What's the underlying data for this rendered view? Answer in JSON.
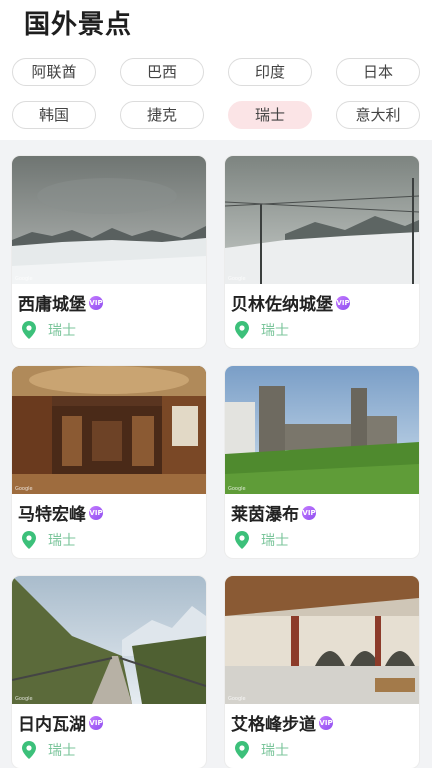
{
  "header": {
    "title": "国外景点"
  },
  "chips": [
    {
      "label": "阿联酋",
      "active": false
    },
    {
      "label": "巴西",
      "active": false
    },
    {
      "label": "印度",
      "active": false
    },
    {
      "label": "日本",
      "active": false
    },
    {
      "label": "韩国",
      "active": false
    },
    {
      "label": "捷克",
      "active": false
    },
    {
      "label": "瑞士",
      "active": true
    },
    {
      "label": "意大利",
      "active": false
    }
  ],
  "vip_badge": "VIP",
  "watermark": "Google",
  "cards": [
    {
      "title": "西庸城堡",
      "location": "瑞士"
    },
    {
      "title": "贝林佐纳城堡",
      "location": "瑞士"
    },
    {
      "title": "马特宏峰",
      "location": "瑞士"
    },
    {
      "title": "莱茵瀑布",
      "location": "瑞士"
    },
    {
      "title": "日内瓦湖",
      "location": "瑞士"
    },
    {
      "title": "艾格峰步道",
      "location": "瑞士"
    }
  ],
  "colors": {
    "active_chip": "#fbe4e6",
    "location_text": "#7bc59b",
    "pin": "#3cc07a",
    "vip": "#9b55f3"
  },
  "icons": [
    "location-pin-icon",
    "vip-badge-icon"
  ]
}
